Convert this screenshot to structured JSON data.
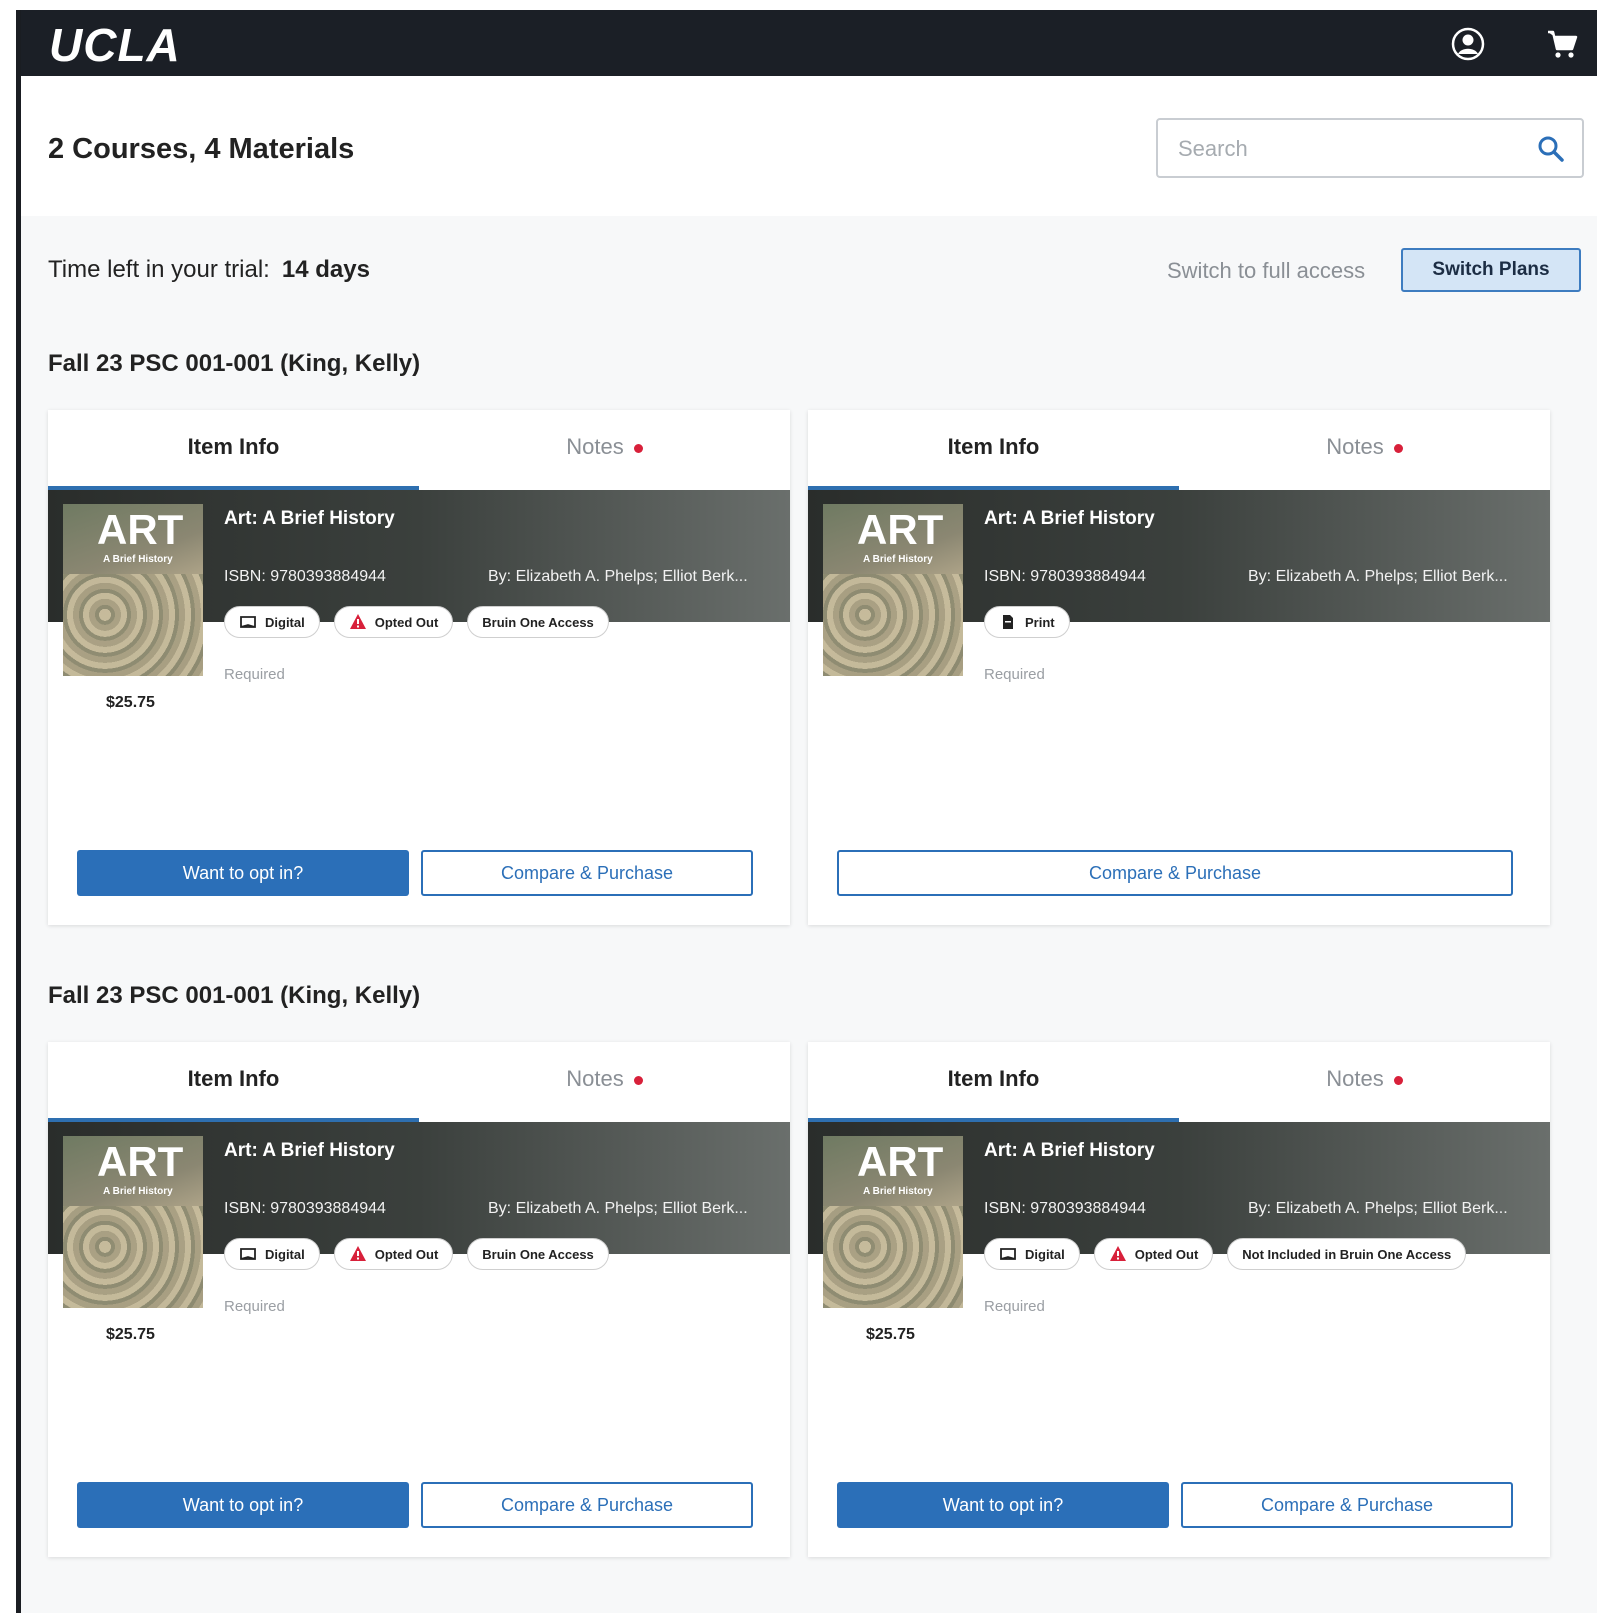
{
  "app": {
    "logo": "UCLA"
  },
  "topbar": {
    "account_icon": "account-circle-icon",
    "cart_icon": "cart-icon"
  },
  "header": {
    "title": "2 Courses, 4 Materials",
    "search_placeholder": "Search"
  },
  "trial": {
    "label": "Time left in your trial:",
    "days": "14 days",
    "switch_text": "Switch to full access",
    "switch_button": "Switch Plans"
  },
  "colors": {
    "topbar": "#1b1f26",
    "accent": "#2b6fb8",
    "notes_dot": "#d8203a",
    "warning": "#d8203a"
  },
  "courses": [
    {
      "title": "Fall 23 PSC 001-001 (King, Kelly)",
      "cards": [
        {
          "tab_info": "Item Info",
          "tab_notes": "Notes",
          "cover_title": "ART",
          "cover_subtitle": "A Brief History",
          "title": "Art: A Brief History",
          "isbn": "ISBN: 9780393884944",
          "author": "By: Elizabeth A. Phelps; Elliot Berk...",
          "chips": [
            {
              "icon": "book-icon",
              "label": "Digital"
            },
            {
              "icon": "warning-icon",
              "label": "Opted Out"
            },
            {
              "icon": "",
              "label": "Bruin One Access"
            }
          ],
          "required": "Required",
          "price": "$25.75",
          "opt_in": "Want to opt in?",
          "compare": "Compare & Purchase"
        },
        {
          "tab_info": "Item Info",
          "tab_notes": "Notes",
          "cover_title": "ART",
          "cover_subtitle": "A Brief History",
          "title": "Art: A Brief History",
          "isbn": "ISBN: 9780393884944",
          "author": "By: Elizabeth A. Phelps; Elliot Berk...",
          "chips": [
            {
              "icon": "print-icon",
              "label": "Print"
            }
          ],
          "required": "Required",
          "price": "",
          "opt_in": "",
          "compare": "Compare & Purchase"
        }
      ]
    },
    {
      "title": "Fall 23 PSC 001-001 (King, Kelly)",
      "cards": [
        {
          "tab_info": "Item Info",
          "tab_notes": "Notes",
          "cover_title": "ART",
          "cover_subtitle": "A Brief History",
          "title": "Art: A Brief History",
          "isbn": "ISBN: 9780393884944",
          "author": "By: Elizabeth A. Phelps; Elliot Berk...",
          "chips": [
            {
              "icon": "book-icon",
              "label": "Digital"
            },
            {
              "icon": "warning-icon",
              "label": "Opted Out"
            },
            {
              "icon": "",
              "label": "Bruin One Access"
            }
          ],
          "required": "Required",
          "price": "$25.75",
          "opt_in": "Want to opt in?",
          "compare": "Compare & Purchase"
        },
        {
          "tab_info": "Item Info",
          "tab_notes": "Notes",
          "cover_title": "ART",
          "cover_subtitle": "A Brief History",
          "title": "Art: A Brief History",
          "isbn": "ISBN: 9780393884944",
          "author": "By: Elizabeth A. Phelps; Elliot Berk...",
          "chips": [
            {
              "icon": "book-icon",
              "label": "Digital"
            },
            {
              "icon": "warning-icon",
              "label": "Opted Out"
            },
            {
              "icon": "",
              "label": "Not Included in Bruin One Access"
            }
          ],
          "required": "Required",
          "price": "$25.75",
          "opt_in": "Want to opt in?",
          "compare": "Compare & Purchase"
        }
      ]
    }
  ]
}
